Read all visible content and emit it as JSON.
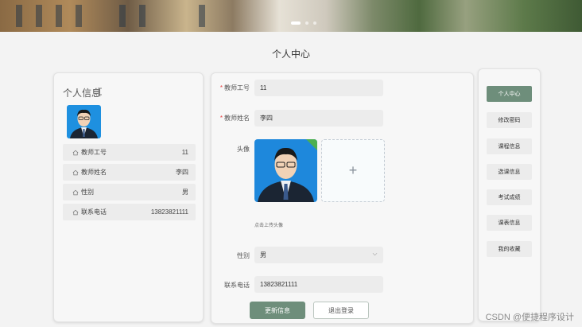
{
  "banner": {
    "slide_count": 3,
    "active_slide": 1
  },
  "page_title": "个人中心",
  "info_card": {
    "title": "个人信息",
    "rows": [
      {
        "label": "教师工号",
        "value": "11",
        "icon": "home-icon"
      },
      {
        "label": "教师姓名",
        "value": "李四",
        "icon": "home-icon"
      },
      {
        "label": "性别",
        "value": "男",
        "icon": "home-icon"
      },
      {
        "label": "联系电话",
        "value": "13823821111",
        "icon": "home-icon"
      }
    ]
  },
  "form": {
    "teacher_id": {
      "label": "教师工号",
      "required": true,
      "value": "11"
    },
    "teacher_name": {
      "label": "教师姓名",
      "required": true,
      "value": "李四"
    },
    "avatar": {
      "label": "头像",
      "upload_hint": "点击上传头像",
      "add_symbol": "+"
    },
    "gender": {
      "label": "性别",
      "value": "男"
    },
    "phone": {
      "label": "联系电话",
      "value": "13823821111"
    },
    "submit_label": "更新信息",
    "logout_label": "退出登录"
  },
  "nav": {
    "items": [
      {
        "label": "个人中心",
        "active": true
      },
      {
        "label": "修改密码",
        "active": false
      },
      {
        "label": "课程信息",
        "active": false
      },
      {
        "label": "选课信息",
        "active": false
      },
      {
        "label": "考试成绩",
        "active": false
      },
      {
        "label": "课表信息",
        "active": false
      },
      {
        "label": "我的收藏",
        "active": false
      }
    ]
  },
  "colors": {
    "accent": "#6e8e7b",
    "required": "#e64242",
    "success": "#4caf50"
  },
  "watermark": "CSDN @便捷程序设计"
}
